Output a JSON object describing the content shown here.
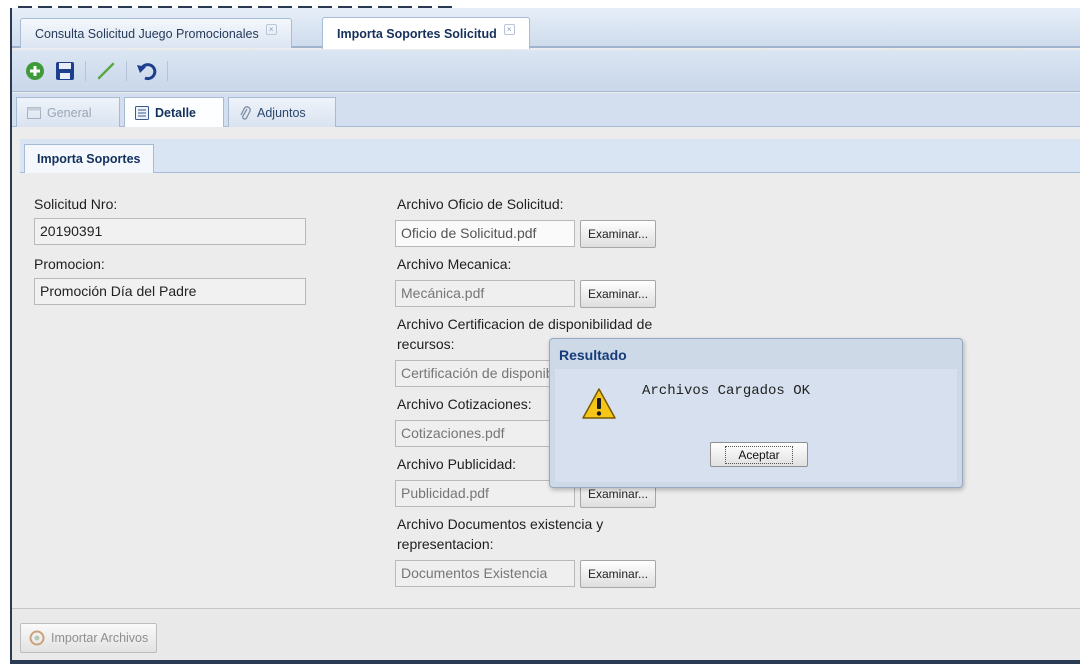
{
  "tabs": [
    {
      "label": "Consulta Solicitud Juego Promocionales",
      "close": "×"
    },
    {
      "label": "Importa Soportes Solicitud",
      "close": "×"
    }
  ],
  "toolbar": {
    "icons": [
      "add-icon",
      "save-icon",
      "edit-icon",
      "undo-icon"
    ]
  },
  "subtabs": [
    {
      "label": "General",
      "state": "disabled"
    },
    {
      "label": "Detalle",
      "state": "active"
    },
    {
      "label": "Adjuntos",
      "state": "normal"
    }
  ],
  "panel": {
    "tab": "Importa Soportes"
  },
  "form": {
    "solicitud_label": "Solicitud Nro:",
    "solicitud_value": "20190391",
    "promocion_label": "Promocion:",
    "promocion_value": "Promoción Día del Padre",
    "files": [
      {
        "label": "Archivo Oficio de Solicitud:",
        "value": "Oficio de Solicitud.pdf"
      },
      {
        "label": "Archivo Mecanica:",
        "value": "Mecánica.pdf"
      },
      {
        "label_line1": "Archivo Certificacion de disponibilidad de",
        "label_line2": "recursos:",
        "value": "Certificación de disponibilidad"
      },
      {
        "label": "Archivo Cotizaciones:",
        "value": "Cotizaciones.pdf"
      },
      {
        "label": "Archivo Publicidad:",
        "value": "Publicidad.pdf"
      },
      {
        "label_line1": "Archivo Documentos existencia y",
        "label_line2": "representacion:",
        "value": "Documentos Existencia"
      }
    ],
    "browse_label": "Examinar..."
  },
  "footer": {
    "import_label": "Importar Archivos"
  },
  "dialog": {
    "title": "Resultado",
    "message": "Archivos Cargados OK",
    "ok_label": "Aceptar"
  },
  "colors": {
    "frame": "#2a3a52",
    "dialog_title": "#153b79",
    "warning": "#f5c518"
  }
}
